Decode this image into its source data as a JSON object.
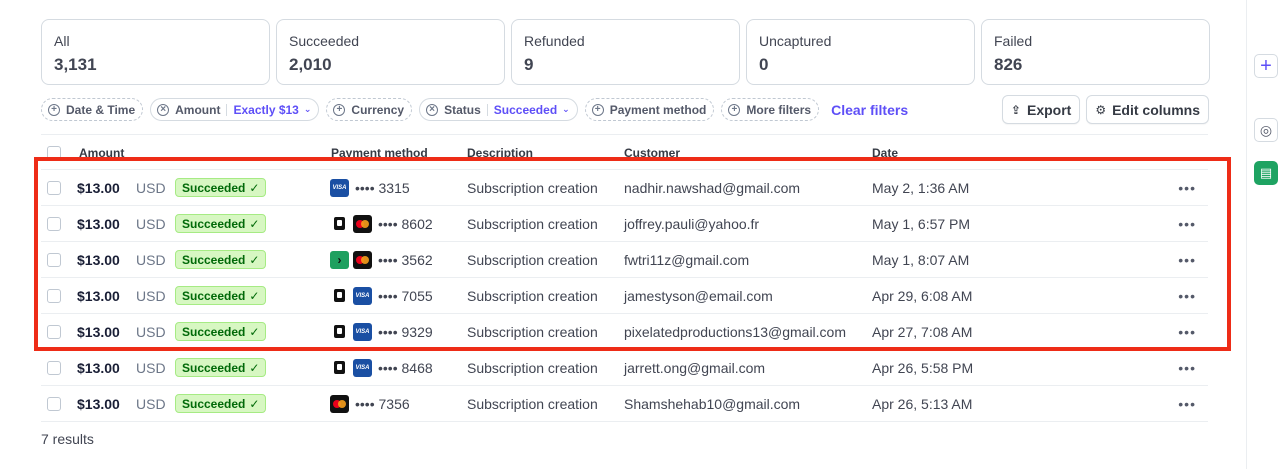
{
  "cards": [
    {
      "label": "All",
      "value": "3,131"
    },
    {
      "label": "Succeeded",
      "value": "2,010"
    },
    {
      "label": "Refunded",
      "value": "9"
    },
    {
      "label": "Uncaptured",
      "value": "0"
    },
    {
      "label": "Failed",
      "value": "826"
    }
  ],
  "filters": {
    "date_time": "Date & Time",
    "amount_label": "Amount",
    "amount_value": "Exactly $13",
    "currency": "Currency",
    "status_label": "Status",
    "status_value": "Succeeded",
    "payment_method": "Payment method",
    "more_filters": "More filters",
    "clear_filters": "Clear filters"
  },
  "actions": {
    "export": "Export",
    "edit_columns": "Edit columns"
  },
  "columns": {
    "amount": "Amount",
    "payment_method": "Payment method",
    "description": "Description",
    "customer": "Customer",
    "date": "Date"
  },
  "rows": [
    {
      "amount": "$13.00",
      "currency": "USD",
      "status": "Succeeded",
      "pm_icons": [
        "visa-icon"
      ],
      "last4": "•••• 3315",
      "description": "Subscription creation",
      "customer": "nadhir.nawshad@gmail.com",
      "date": "May 2, 1:36 AM"
    },
    {
      "amount": "$13.00",
      "currency": "USD",
      "status": "Succeeded",
      "pm_icons": [
        "link-icon",
        "mastercard-icon"
      ],
      "last4": "•••• 8602",
      "description": "Subscription creation",
      "customer": "joffrey.pauli@yahoo.fr",
      "date": "May 1, 6:57 PM"
    },
    {
      "amount": "$13.00",
      "currency": "USD",
      "status": "Succeeded",
      "pm_icons": [
        "arrow-icon",
        "mastercard-icon"
      ],
      "last4": "•••• 3562",
      "description": "Subscription creation",
      "customer": "fwtri11z@gmail.com",
      "date": "May 1, 8:07 AM"
    },
    {
      "amount": "$13.00",
      "currency": "USD",
      "status": "Succeeded",
      "pm_icons": [
        "link-icon",
        "visa-icon"
      ],
      "last4": "•••• 7055",
      "description": "Subscription creation",
      "customer": "jamestyson@email.com",
      "date": "Apr 29, 6:08 AM"
    },
    {
      "amount": "$13.00",
      "currency": "USD",
      "status": "Succeeded",
      "pm_icons": [
        "link-icon",
        "visa-icon"
      ],
      "last4": "•••• 9329",
      "description": "Subscription creation",
      "customer": "pixelatedproductions13@gmail.com",
      "date": "Apr 27, 7:08 AM"
    },
    {
      "amount": "$13.00",
      "currency": "USD",
      "status": "Succeeded",
      "pm_icons": [
        "link-icon",
        "visa-icon"
      ],
      "last4": "•••• 8468",
      "description": "Subscription creation",
      "customer": "jarrett.ong@gmail.com",
      "date": "Apr 26, 5:58 PM"
    },
    {
      "amount": "$13.00",
      "currency": "USD",
      "status": "Succeeded",
      "pm_icons": [
        "mastercard-icon"
      ],
      "last4": "•••• 7356",
      "description": "Subscription creation",
      "customer": "Shamshehab10@gmail.com",
      "date": "Apr 26, 5:13 AM"
    }
  ],
  "results_count": "7 results",
  "colors": {
    "accent": "#5e4ff7",
    "success_bg": "#d7f7c2",
    "success_text": "#006908",
    "highlight": "#ee2c17"
  }
}
